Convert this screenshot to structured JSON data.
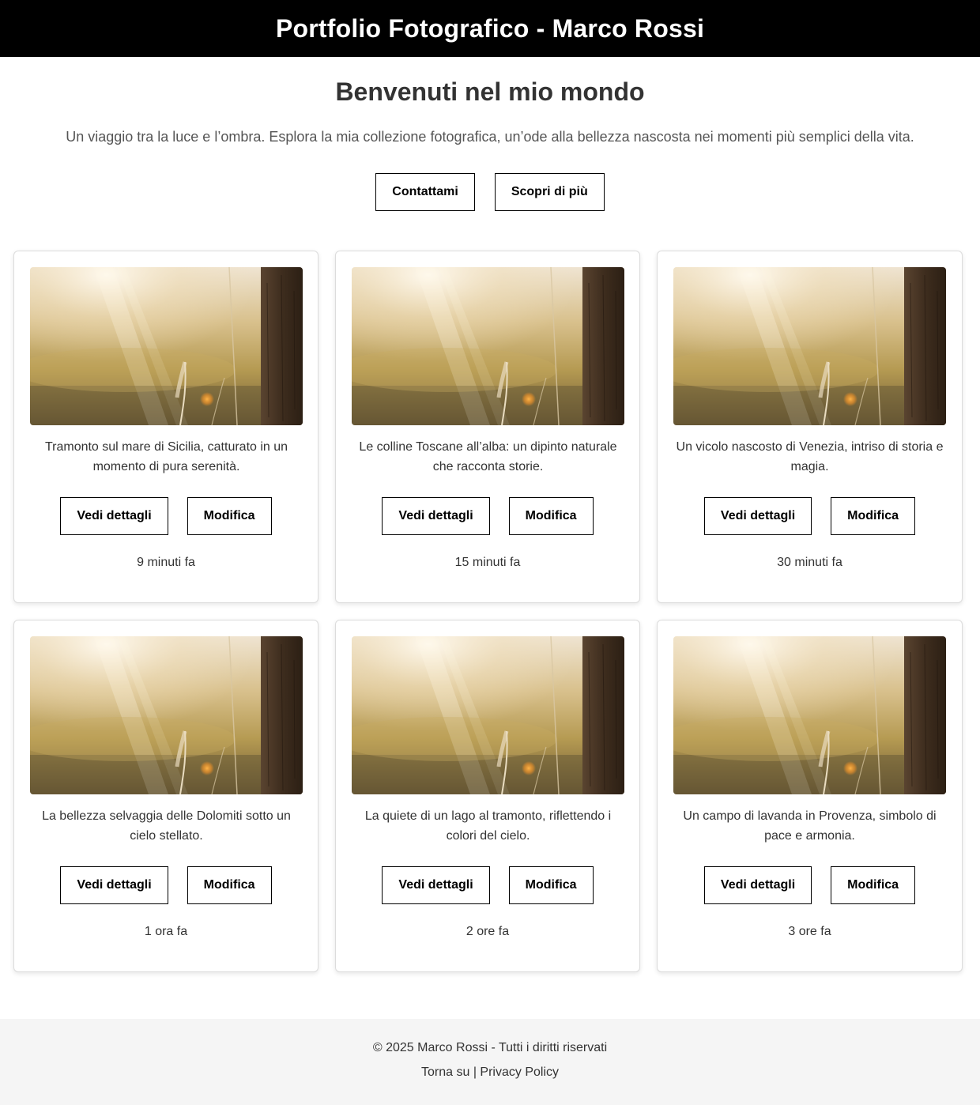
{
  "header": {
    "title": "Portfolio Fotografico - Marco Rossi"
  },
  "hero": {
    "heading": "Benvenuti nel mio mondo",
    "subtitle": "Un viaggio tra la luce e l’ombra. Esplora la mia collezione fotografica, un’ode alla bellezza nascosta nei momenti più semplici della vita.",
    "contact_label": "Contattami",
    "discover_label": "Scopri di più"
  },
  "cards": [
    {
      "caption": "Tramonto sul mare di Sicilia, catturato in un momento di pura serenità.",
      "details_label": "Vedi dettagli",
      "edit_label": "Modifica",
      "time": "9 minuti fa"
    },
    {
      "caption": "Le colline Toscane all’alba: un dipinto naturale che racconta storie.",
      "details_label": "Vedi dettagli",
      "edit_label": "Modifica",
      "time": "15 minuti fa"
    },
    {
      "caption": "Un vicolo nascosto di Venezia, intriso di storia e magia.",
      "details_label": "Vedi dettagli",
      "edit_label": "Modifica",
      "time": "30 minuti fa"
    },
    {
      "caption": "La bellezza selvaggia delle Dolomiti sotto un cielo stellato.",
      "details_label": "Vedi dettagli",
      "edit_label": "Modifica",
      "time": "1 ora fa"
    },
    {
      "caption": "La quiete di un lago al tramonto, riflettendo i colori del cielo.",
      "details_label": "Vedi dettagli",
      "edit_label": "Modifica",
      "time": "2 ore fa"
    },
    {
      "caption": "Un campo di lavanda in Provenza, simbolo di pace e armonia.",
      "details_label": "Vedi dettagli",
      "edit_label": "Modifica",
      "time": "3 ore fa"
    }
  ],
  "footer": {
    "copyright": "© 2025 Marco Rossi - Tutti i diritti riservati",
    "back_to_top": "Torna su",
    "separator": " | ",
    "privacy": "Privacy Policy"
  },
  "colors": {
    "header_bg": "#000000",
    "header_text": "#ffffff",
    "footer_bg": "#f5f5f5",
    "card_border": "#dcdcdc"
  }
}
